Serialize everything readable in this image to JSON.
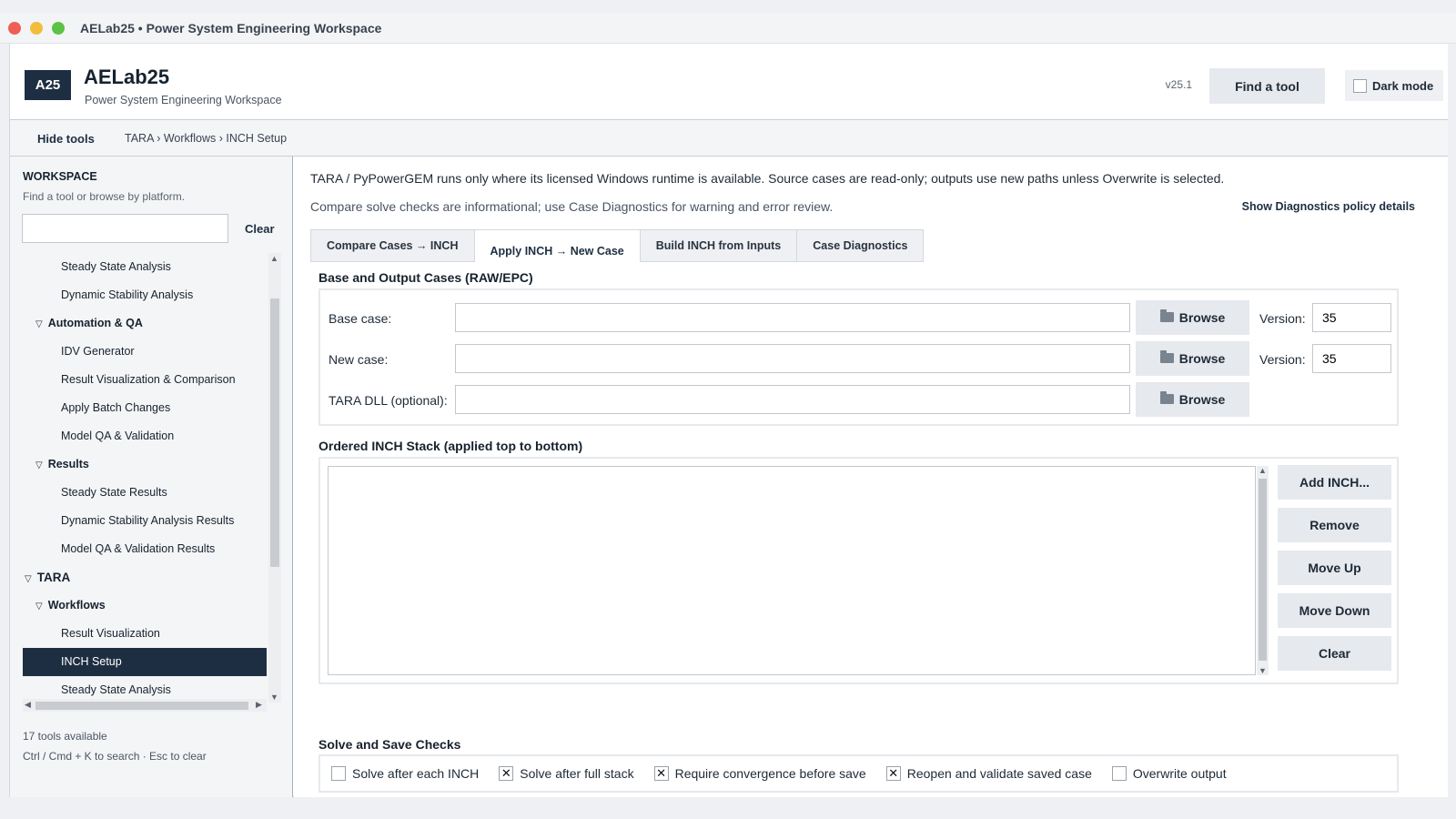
{
  "window": {
    "title": "AELab25 • Power System Engineering Workspace"
  },
  "header": {
    "logo": "A25",
    "app_name": "AELab25",
    "subtitle": "Power System Engineering Workspace",
    "version": "v25.1",
    "find_tool": "Find a tool",
    "dark_mode": "Dark mode",
    "dark_mode_checked": false
  },
  "toolbar": {
    "hide_tools": "Hide tools",
    "breadcrumb": "TARA › Workflows › INCH Setup"
  },
  "sidebar": {
    "title": "WORKSPACE",
    "subtitle": "Find a tool or browse by platform.",
    "search_value": "",
    "clear": "Clear",
    "items": [
      {
        "label": "Steady State Analysis",
        "level": 2
      },
      {
        "label": "Dynamic Stability Analysis",
        "level": 2
      },
      {
        "label": "Automation & QA",
        "level": 1
      },
      {
        "label": "IDV Generator",
        "level": 2
      },
      {
        "label": "Result Visualization & Comparison",
        "level": 2
      },
      {
        "label": "Apply Batch Changes",
        "level": 2
      },
      {
        "label": "Model QA & Validation",
        "level": 2
      },
      {
        "label": "Results",
        "level": 1
      },
      {
        "label": "Steady State Results",
        "level": 2
      },
      {
        "label": "Dynamic Stability Analysis Results",
        "level": 2
      },
      {
        "label": "Model QA & Validation Results",
        "level": 2
      },
      {
        "label": "TARA",
        "level": 0
      },
      {
        "label": "Workflows",
        "level": 1
      },
      {
        "label": "Result Visualization",
        "level": 2
      },
      {
        "label": "INCH Setup",
        "level": 2,
        "selected": true
      },
      {
        "label": "Steady State Analysis",
        "level": 2
      }
    ],
    "footer_count": "17 tools available",
    "footer_hint": "Ctrl / Cmd + K to search · Esc to clear"
  },
  "main": {
    "notice": "TARA / PyPowerGEM runs only where its licensed Windows runtime is available. Source cases are read-only; outputs use new paths unless Overwrite is selected.",
    "notice2": "Compare solve checks are informational; use Case Diagnostics for warning and error review.",
    "policy_link": "Show Diagnostics policy details",
    "tabs": [
      {
        "label": "Compare Cases → INCH",
        "active": false
      },
      {
        "label": "Apply INCH → New Case",
        "active": true
      },
      {
        "label": "Build INCH from Inputs",
        "active": false
      },
      {
        "label": "Case Diagnostics",
        "active": false
      }
    ],
    "cases_section": {
      "title": "Base and Output Cases (RAW/EPC)",
      "base_label": "Base case:",
      "base_value": "",
      "new_label": "New case:",
      "new_value": "",
      "dll_label": "TARA DLL (optional):",
      "dll_value": "",
      "browse": "Browse",
      "version_label": "Version:",
      "base_version": "35",
      "new_version": "35"
    },
    "stack_section": {
      "title": "Ordered INCH Stack (applied top to bottom)",
      "items": [],
      "add": "Add INCH...",
      "remove": "Remove",
      "move_up": "Move Up",
      "move_down": "Move Down",
      "clear": "Clear"
    },
    "checks_section": {
      "title": "Solve and Save Checks",
      "checks": [
        {
          "label": "Solve after each INCH",
          "checked": false
        },
        {
          "label": "Solve after full stack",
          "checked": true
        },
        {
          "label": "Require convergence before save",
          "checked": true
        },
        {
          "label": "Reopen and validate saved case",
          "checked": true
        },
        {
          "label": "Overwrite output",
          "checked": false
        }
      ]
    }
  },
  "colors": {
    "accent": "#1e2e42",
    "selected_bg": "#1e2e42",
    "button_bg": "#e6e9ed"
  }
}
